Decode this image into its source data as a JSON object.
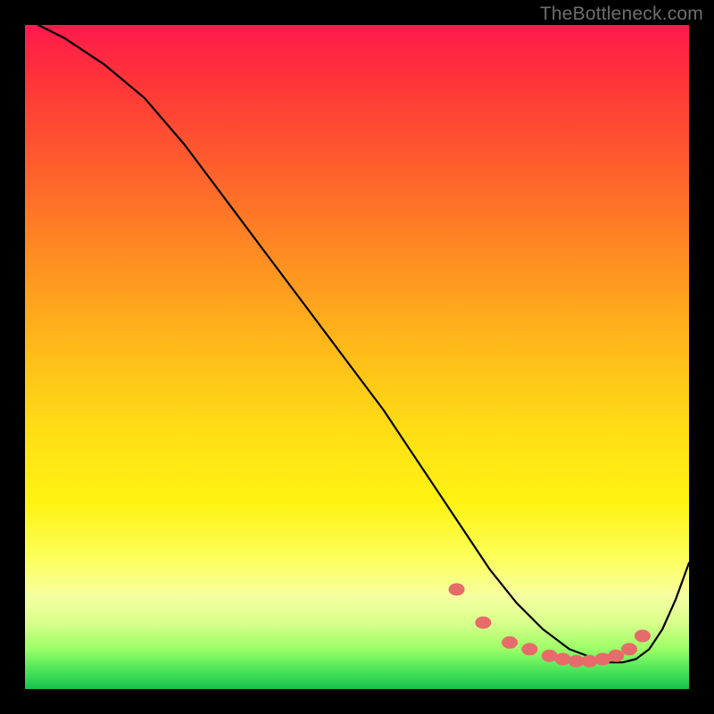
{
  "watermark": "TheBottleneck.com",
  "colors": {
    "gradient_top": "#ff1a4d",
    "gradient_mid_orange": "#ff8a22",
    "gradient_mid_yellow": "#ffe014",
    "gradient_bottom": "#17c24d",
    "curve": "#000000",
    "dots": "#e76b6b",
    "background": "#000000"
  },
  "chart_data": {
    "type": "line",
    "title": "",
    "xlabel": "",
    "ylabel": "",
    "xlim": [
      0,
      100
    ],
    "ylim": [
      0,
      100
    ],
    "grid": false,
    "series": [
      {
        "name": "bottleneck-curve",
        "x": [
          2,
          6,
          12,
          18,
          24,
          30,
          36,
          42,
          48,
          54,
          58,
          62,
          66,
          70,
          74,
          78,
          82,
          86,
          88,
          90,
          92,
          94,
          96,
          98,
          100
        ],
        "values": [
          100,
          98,
          94,
          89,
          82,
          74,
          66,
          58,
          50,
          42,
          36,
          30,
          24,
          18,
          13,
          9,
          6,
          4.5,
          4,
          4,
          4.5,
          6,
          9,
          13.5,
          19
        ]
      }
    ],
    "highlight_points": {
      "name": "optimal-region-dots",
      "x": [
        65,
        69,
        73,
        76,
        79,
        81,
        83,
        85,
        87,
        89,
        91,
        93
      ],
      "values": [
        15,
        10,
        7,
        6,
        5,
        4.5,
        4.2,
        4.2,
        4.5,
        5,
        6,
        8
      ]
    }
  }
}
